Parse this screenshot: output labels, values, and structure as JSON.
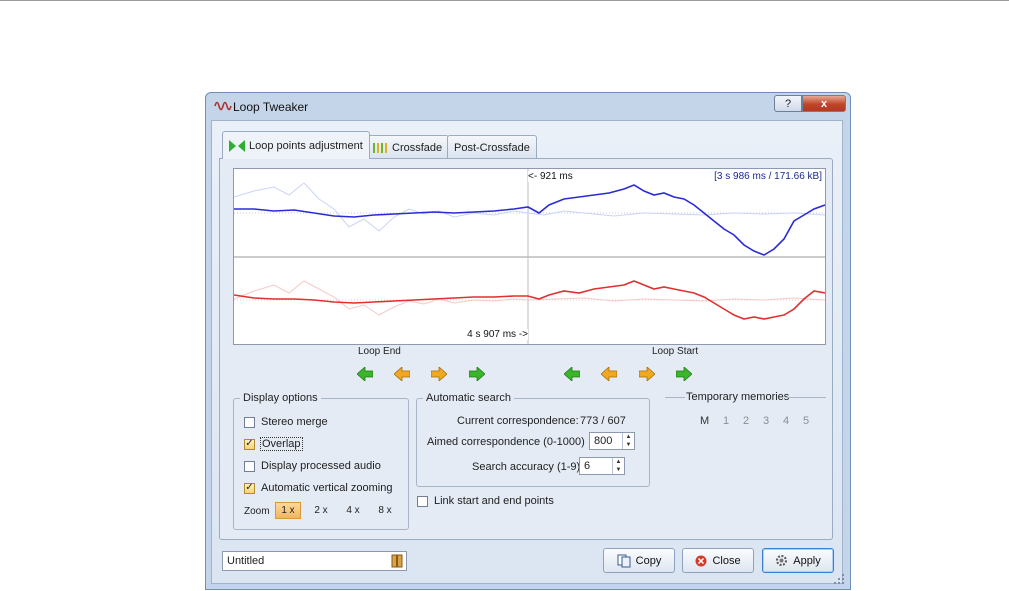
{
  "window": {
    "title": "Loop Tweaker",
    "help_label": "?",
    "close_label": "x"
  },
  "tabs": [
    {
      "label": "Loop points adjustment",
      "active": true
    },
    {
      "label": "Crossfade",
      "active": false
    },
    {
      "label": "Post-Crossfade",
      "active": false
    }
  ],
  "waveform": {
    "left_marker": "<- 921 ms",
    "info": "[3 s 986 ms / 171.66 kB]",
    "bottom_marker": "4 s 907 ms ->"
  },
  "loop_end": {
    "label": "Loop End"
  },
  "loop_start": {
    "label": "Loop Start"
  },
  "display_options": {
    "title": "Display options",
    "stereo_merge": {
      "label": "Stereo merge",
      "checked": false
    },
    "overlap": {
      "label": "Overlap",
      "checked": true
    },
    "display_processed": {
      "label": "Display processed audio",
      "checked": false
    },
    "auto_zoom": {
      "label": "Automatic vertical zooming",
      "checked": true
    },
    "zoom_label": "Zoom",
    "zoom_options": [
      "1 x",
      "2 x",
      "4 x",
      "8 x"
    ],
    "zoom_selected": "1 x"
  },
  "automatic_search": {
    "title": "Automatic search",
    "current_label": "Current correspondence:",
    "current_value": "773 / 607",
    "aimed_label": "Aimed correspondence (0-1000)",
    "aimed_value": "800",
    "accuracy_label": "Search accuracy (1-9)",
    "accuracy_value": "6"
  },
  "link_points": {
    "label": "Link start and end points",
    "checked": false
  },
  "temporary_memories": {
    "title": "Temporary memories",
    "items": [
      "M",
      "1",
      "2",
      "3",
      "4",
      "5"
    ]
  },
  "footer": {
    "name_value": "Untitled",
    "copy_label": "Copy",
    "close_label": "Close",
    "apply_label": "Apply"
  },
  "colors": {
    "channel_top": "#2b2bd6",
    "channel_bottom": "#e03030",
    "accent_green": "#3bb52a",
    "accent_orange": "#f1a820"
  }
}
